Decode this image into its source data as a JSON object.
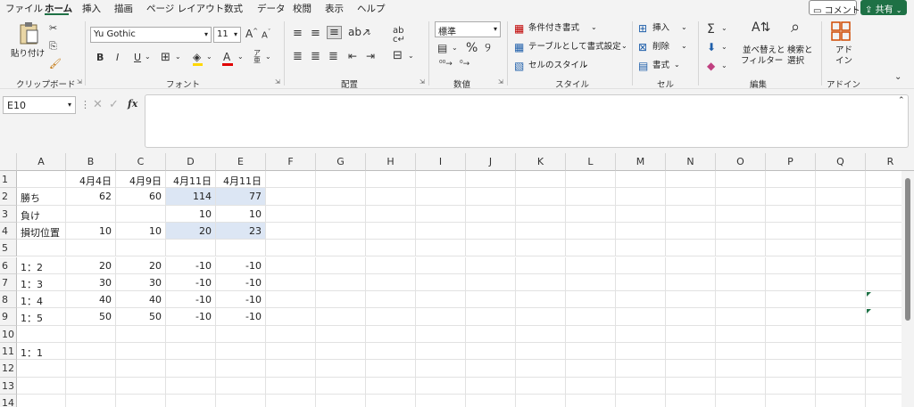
{
  "menu": {
    "tabs": [
      "ファイル",
      "ホーム",
      "挿入",
      "描画",
      "ページ レイアウト",
      "数式",
      "データ",
      "校閲",
      "表示",
      "ヘルプ"
    ],
    "active_tab": "ホーム",
    "comment_label": "コメント",
    "share_label": "共有"
  },
  "ribbon": {
    "clipboard": {
      "paste_label": "貼り付け",
      "group_label": "クリップボード"
    },
    "font": {
      "font_name": "Yu Gothic",
      "font_size": "11",
      "bold": "B",
      "italic": "I",
      "underline": "U",
      "group_label": "フォント",
      "grow_label": "A",
      "shrink_label": "A"
    },
    "alignment": {
      "group_label": "配置"
    },
    "number": {
      "format": "標準",
      "percent": "%",
      "group_label": "数値"
    },
    "styles": {
      "conditional_label": "条件付き書式",
      "table_label": "テーブルとして書式設定",
      "cell_styles_label": "セルのスタイル",
      "group_label": "スタイル"
    },
    "cells": {
      "insert_label": "挿入",
      "delete_label": "削除",
      "format_label": "書式",
      "group_label": "セル"
    },
    "editing": {
      "sort_label_1": "並べ替えと",
      "sort_label_2": "フィルター",
      "find_label_1": "検索と",
      "find_label_2": "選択",
      "group_label": "編集"
    },
    "addins": {
      "label_1": "アド",
      "label_2": "イン",
      "group_label": "アドイン"
    }
  },
  "formula_bar": {
    "name_box": "E10",
    "fx": "fx",
    "content": ""
  },
  "sheet": {
    "columns": [
      "A",
      "B",
      "C",
      "D",
      "E",
      "F",
      "G",
      "H",
      "I",
      "J",
      "K",
      "L",
      "M",
      "N",
      "O",
      "P",
      "Q",
      "R"
    ],
    "rows": [
      "1",
      "2",
      "3",
      "4",
      "5",
      "6",
      "7",
      "8",
      "9",
      "10",
      "11",
      "12",
      "13",
      "14"
    ],
    "cells": [
      [
        "",
        "4月4日",
        "4月9日",
        "4月11日",
        "4月11日"
      ],
      [
        "勝ち",
        "62",
        "60",
        "114",
        "77"
      ],
      [
        "負け",
        "",
        "",
        "10",
        "10"
      ],
      [
        "損切位置",
        "10",
        "10",
        "20",
        "23"
      ],
      [
        "",
        "",
        "",
        "",
        ""
      ],
      [
        "1：2",
        "20",
        "20",
        "-10",
        "-10"
      ],
      [
        "1：3",
        "30",
        "30",
        "-10",
        "-10"
      ],
      [
        "1：4",
        "40",
        "40",
        "-10",
        "-10"
      ],
      [
        "1：5",
        "50",
        "50",
        "-10",
        "-10"
      ],
      [
        "",
        "",
        "",
        "",
        ""
      ],
      [
        "1：1",
        "",
        "",
        "",
        ""
      ],
      [
        "",
        "",
        "",
        "",
        ""
      ],
      [
        "",
        "",
        "",
        "",
        ""
      ],
      [
        "",
        "",
        "",
        "",
        ""
      ]
    ]
  },
  "colors": {
    "accent": "#1e7145",
    "selection": "#dce6f4"
  }
}
